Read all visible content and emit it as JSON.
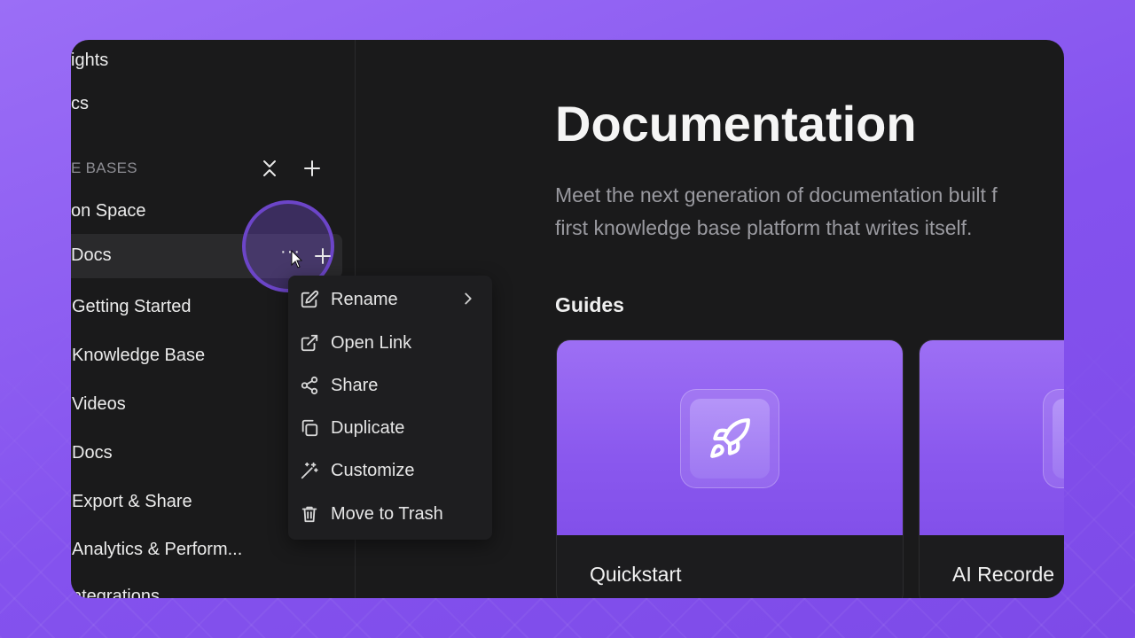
{
  "sidebar": {
    "items_top": [
      "ights",
      "cs"
    ],
    "section_label": "E BASES",
    "space_label": "on Space",
    "active_item": "Docs",
    "children": [
      "Getting Started",
      "Knowledge Base",
      "Videos",
      "Docs",
      "Export & Share",
      "Analytics & Perform...",
      "ntegrations"
    ],
    "more_glyph": "···",
    "icons": {
      "collapse": "collapse-vertical-icon",
      "add": "plus-icon",
      "more": "more-horizontal-icon"
    }
  },
  "context_menu": {
    "items": [
      {
        "label": "Rename",
        "icon": "edit-icon"
      },
      {
        "label": "Open Link",
        "icon": "external-link-icon"
      },
      {
        "label": "Share",
        "icon": "share-icon"
      },
      {
        "label": "Duplicate",
        "icon": "duplicate-icon"
      },
      {
        "label": "Customize",
        "icon": "magic-wand-icon"
      },
      {
        "label": "Move to Trash",
        "icon": "trash-icon"
      }
    ]
  },
  "main": {
    "title": "Documentation",
    "description_line1": "Meet the next generation of documentation built f",
    "description_line2": "first knowledge base platform that writes itself.",
    "guides_heading": "Guides",
    "cards": [
      {
        "title": "Quickstart",
        "icon": "rocket-icon"
      },
      {
        "title": "AI Recorde",
        "icon": "app-icon"
      }
    ]
  },
  "colors": {
    "background": "#8b5cf6",
    "window": "#1a1a1b",
    "accent": "#8a58ee",
    "text": "#f5f5f5",
    "muted": "#9a9aa0"
  }
}
